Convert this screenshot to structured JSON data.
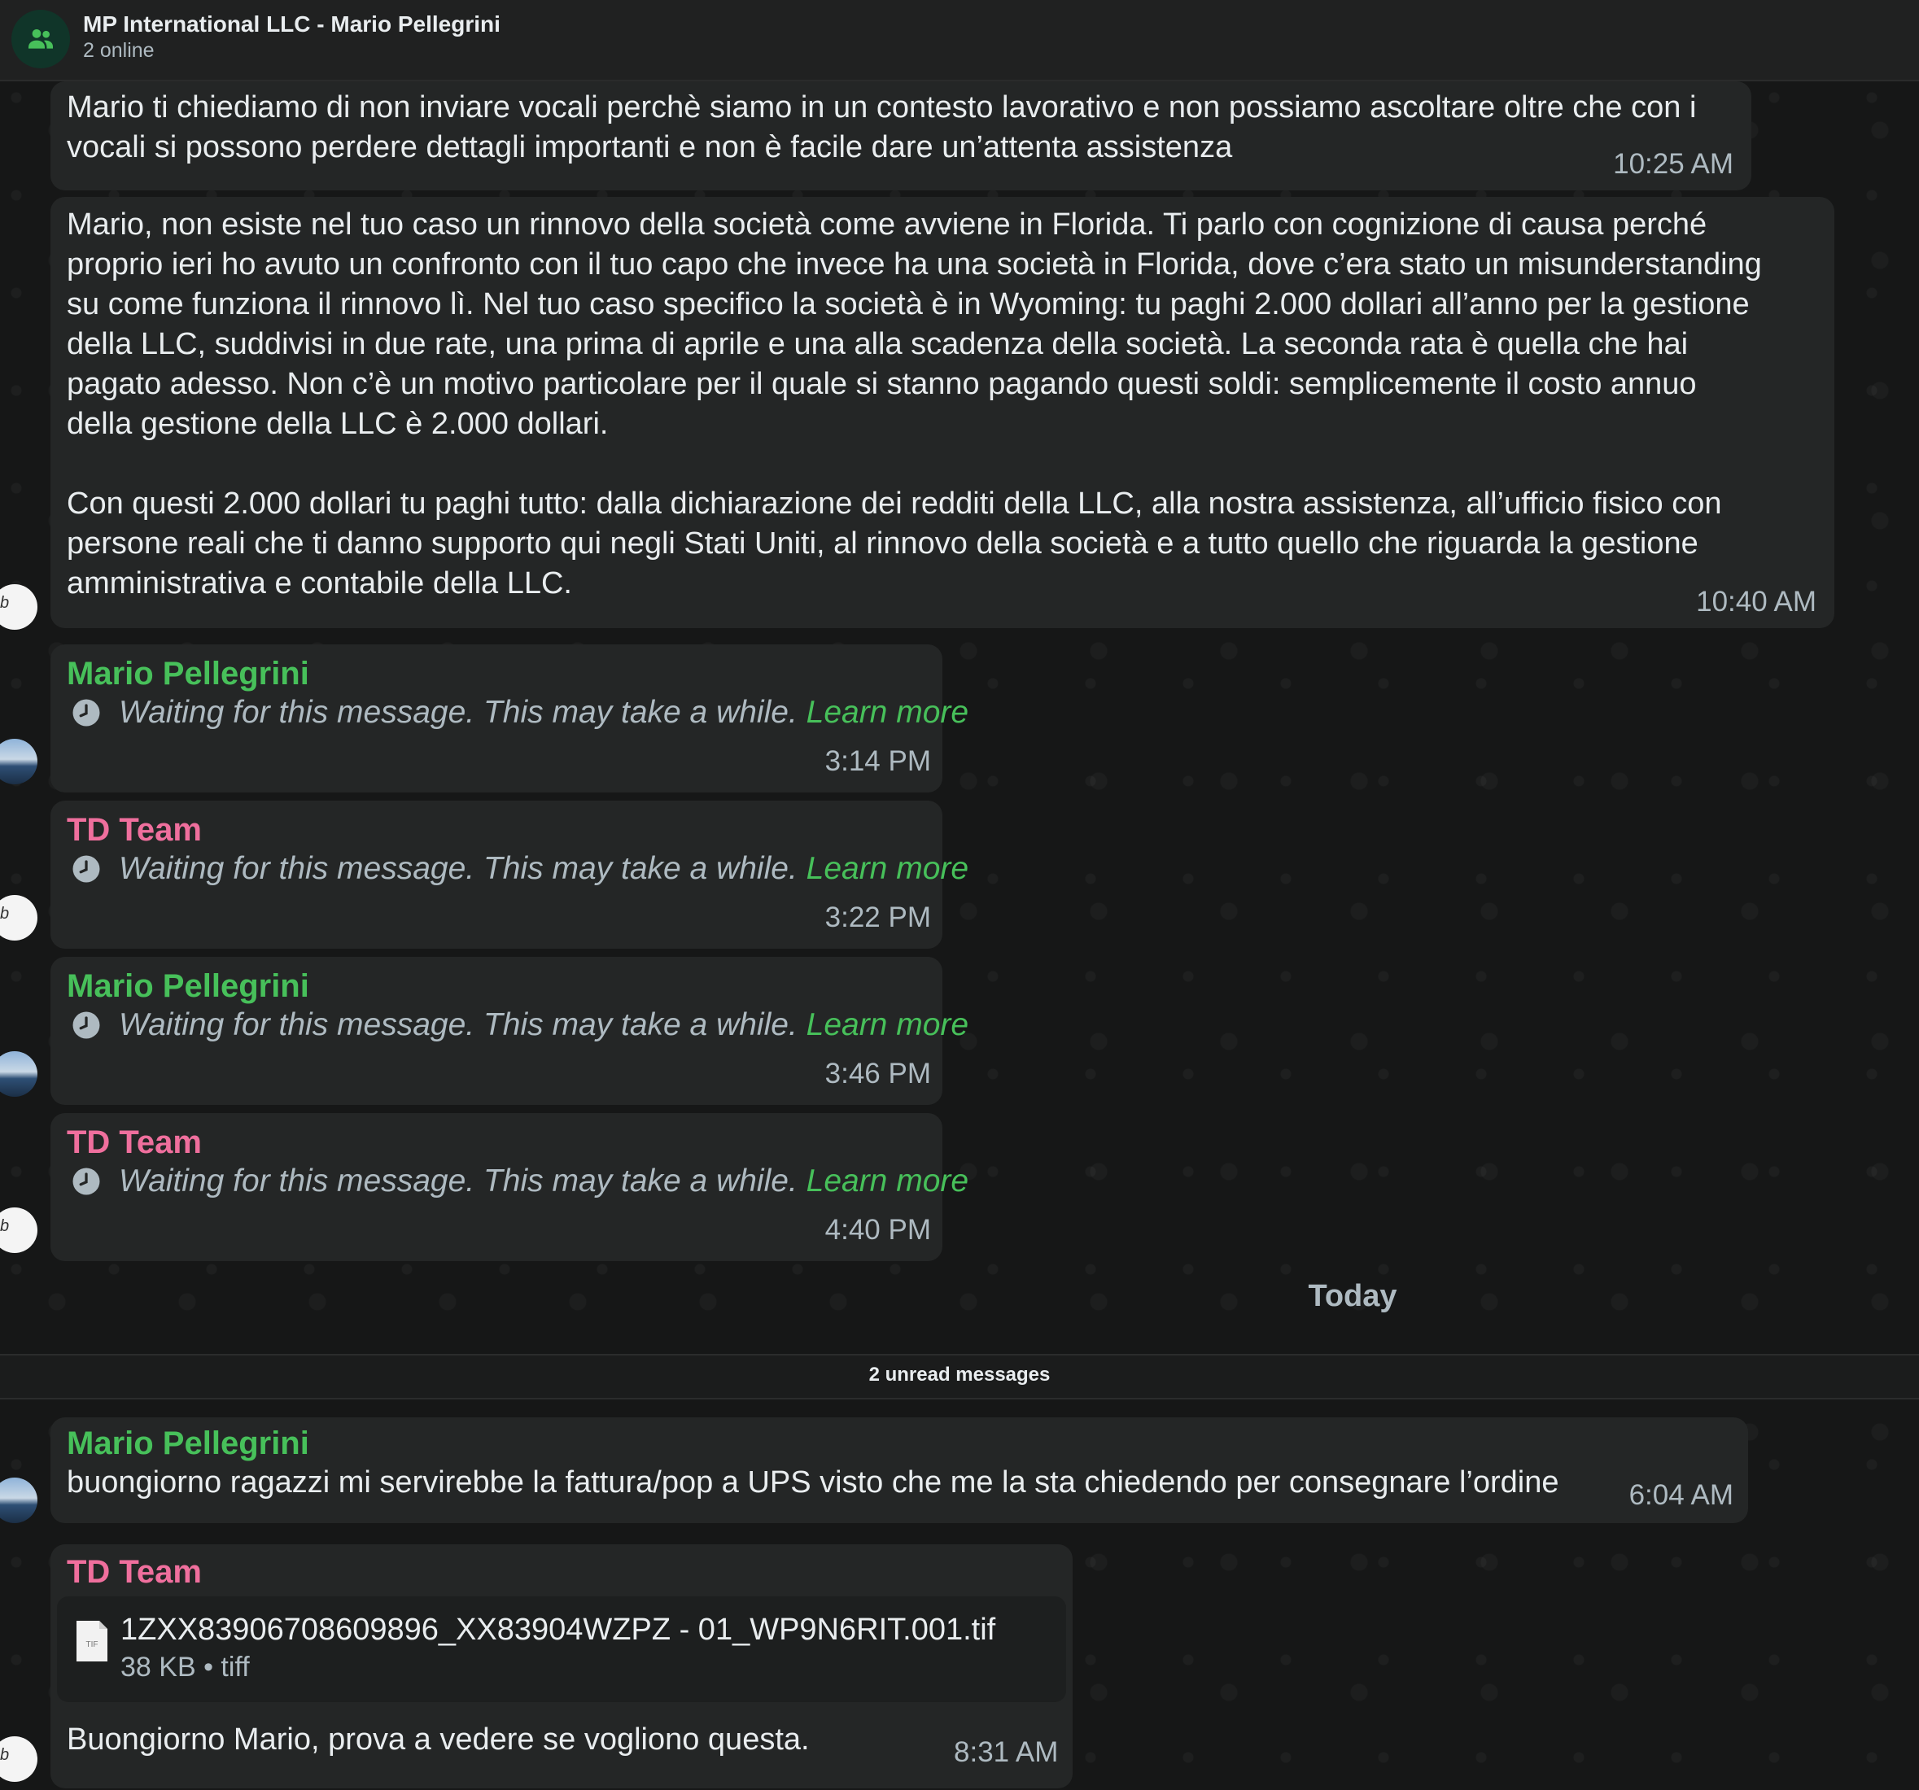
{
  "header": {
    "title": "MP International LLC - Mario Pellegrini",
    "subtitle": "2 online",
    "avatar_icon": "group-icon"
  },
  "messages": [
    {
      "text": "Mario ti chiediamo di non inviare vocali perchè siamo in un contesto lavorativo e non possiamo ascoltare oltre che con i\nvocali si possono perdere dettagli importanti e non è facile dare un’attenta assistenza",
      "time": "10:25 AM"
    },
    {
      "text": "Mario, non esiste nel tuo caso un rinnovo della società come avviene in Florida. Ti parlo con cognizione di causa perché\nproprio ieri ho avuto un confronto con il tuo capo che invece ha una società in Florida, dove c’era stato un misunderstanding\nsu come funziona il rinnovo lì. Nel tuo caso specifico la società è in Wyoming: tu paghi 2.000 dollari all’anno per la gestione\ndella LLC, suddivisi in due rate, una prima di aprile e una alla scadenza della società. La seconda rata è quella che hai\npagato adesso. Non c’è un motivo particolare per il quale si stanno pagando questi soldi: semplicemente il costo annuo\ndella gestione della LLC è 2.000 dollari.\n\nCon questi 2.000 dollari tu paghi tutto: dalla dichiarazione dei redditi della LLC, alla nostra assistenza, all’ufficio fisico con\npersone reali che ti danno supporto qui negli Stati Uniti, al rinnovo della società e a tutto quello che riguarda la gestione\namministrativa e contabile della LLC.",
      "time": "10:40 AM"
    },
    {
      "sender": "Mario Pellegrini",
      "waiting": "Waiting for this message. This may take a while.",
      "learn": "Learn more",
      "time": "3:14 PM"
    },
    {
      "sender": "TD Team",
      "waiting": "Waiting for this message. This may take a while.",
      "learn": "Learn more",
      "time": "3:22 PM"
    },
    {
      "sender": "Mario Pellegrini",
      "waiting": "Waiting for this message. This may take a while.",
      "learn": "Learn more",
      "time": "3:46 PM"
    },
    {
      "sender": "TD Team",
      "waiting": "Waiting for this message. This may take a while.",
      "learn": "Learn more",
      "time": "4:40 PM"
    },
    {
      "sender": "Mario Pellegrini",
      "text": "buongiorno ragazzi mi servirebbe la fattura/pop a UPS visto che me la sta chiedendo per consegnare l’ordine",
      "time": "6:04 AM"
    },
    {
      "sender": "TD Team",
      "file": {
        "name": "1ZXX83906708609896_XX83904WZPZ - 01_WP9N6RIT.001.tif",
        "meta": "38 KB • tiff",
        "icon_label": "TIF"
      },
      "text": "Buongiorno Mario, prova a vedere se vogliono questa.",
      "time": "8:31 AM"
    }
  ],
  "day_divider": "Today",
  "unread": "2 unread messages",
  "colors": {
    "sender_mario": "#47c05a",
    "sender_td": "#ef6f9d",
    "bubble": "#242626",
    "background": "#161717"
  }
}
